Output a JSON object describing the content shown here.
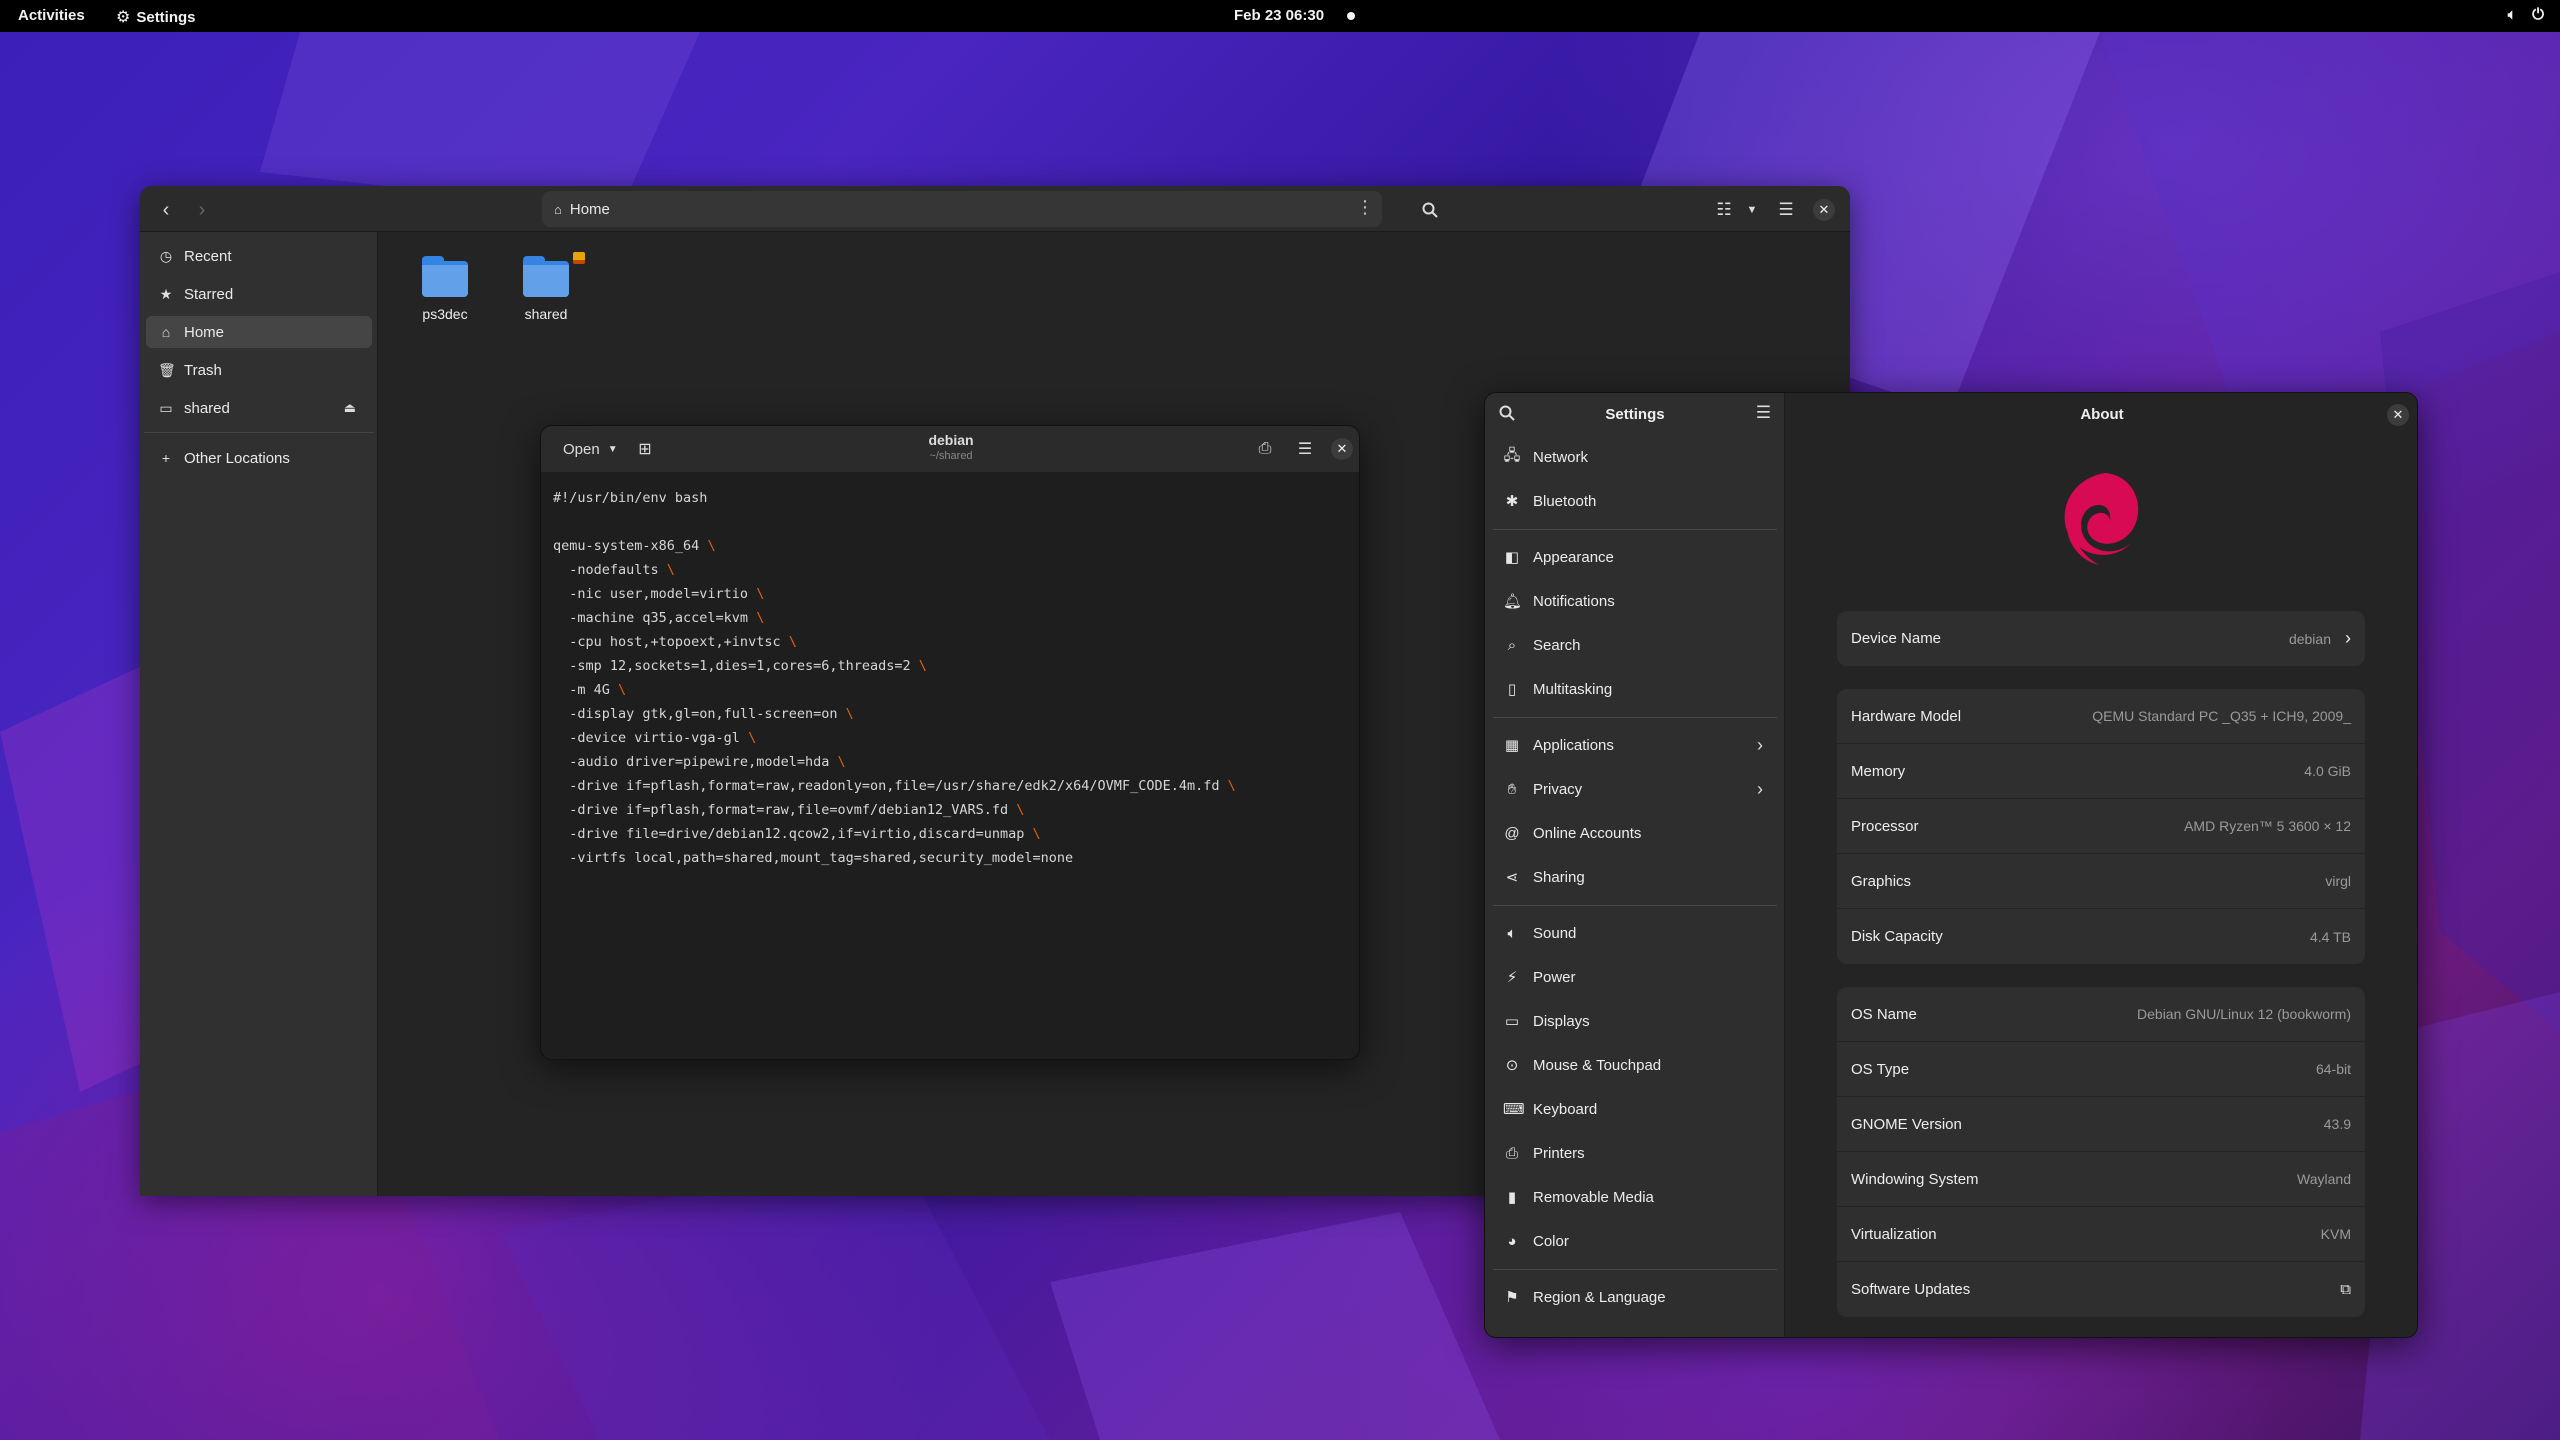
{
  "topbar": {
    "activities": "Activities",
    "app_name": "Settings",
    "clock": "Feb 23  06:30"
  },
  "files": {
    "path": "Home",
    "sidebar": [
      {
        "label": "Recent",
        "icon": "clock-icon"
      },
      {
        "label": "Starred",
        "icon": "star-icon"
      },
      {
        "label": "Home",
        "icon": "home-icon"
      },
      {
        "label": "Trash",
        "icon": "trash-icon"
      },
      {
        "label": "shared",
        "icon": "drive-icon"
      },
      {
        "label": "Other Locations",
        "icon": "plus-icon"
      }
    ],
    "folders": [
      {
        "name": "ps3dec"
      },
      {
        "name": "shared"
      }
    ]
  },
  "editor": {
    "open_label": "Open",
    "title": "debian",
    "subtitle": "~/shared",
    "lines": [
      {
        "text": "#!/usr/bin/env bash",
        "cont": false
      },
      {
        "text": "",
        "cont": false
      },
      {
        "text": "qemu-system-x86_64 ",
        "cont": true
      },
      {
        "text": "  -nodefaults ",
        "cont": true
      },
      {
        "text": "  -nic user,model=virtio ",
        "cont": true
      },
      {
        "text": "  -machine q35,accel=kvm ",
        "cont": true
      },
      {
        "text": "  -cpu host,+topoext,+invtsc ",
        "cont": true
      },
      {
        "text": "  -smp 12,sockets=1,dies=1,cores=6,threads=2 ",
        "cont": true
      },
      {
        "text": "  -m 4G ",
        "cont": true
      },
      {
        "text": "  -display gtk,gl=on,full-screen=on ",
        "cont": true
      },
      {
        "text": "  -device virtio-vga-gl ",
        "cont": true
      },
      {
        "text": "  -audio driver=pipewire,model=hda ",
        "cont": true
      },
      {
        "text": "  -drive if=pflash,format=raw,readonly=on,file=/usr/share/edk2/x64/OVMF_CODE.4m.fd ",
        "cont": true
      },
      {
        "text": "  -drive if=pflash,format=raw,file=ovmf/debian12_VARS.fd ",
        "cont": true
      },
      {
        "text": "  -drive file=drive/debian12.qcow2,if=virtio,discard=unmap ",
        "cont": true
      },
      {
        "text": "  -virtfs local,path=shared,mount_tag=shared,security_model=none",
        "cont": false
      }
    ]
  },
  "settings": {
    "sidebar_title": "Settings",
    "main_title": "About",
    "items": [
      {
        "label": "Network",
        "icon": "network-icon",
        "chevron": false
      },
      {
        "label": "Bluetooth",
        "icon": "bluetooth-icon",
        "chevron": false
      },
      {
        "label": "Appearance",
        "icon": "appearance-icon",
        "chevron": false
      },
      {
        "label": "Notifications",
        "icon": "bell-icon",
        "chevron": false
      },
      {
        "label": "Search",
        "icon": "search-icon",
        "chevron": false
      },
      {
        "label": "Multitasking",
        "icon": "multitasking-icon",
        "chevron": false
      },
      {
        "label": "Applications",
        "icon": "grid-icon",
        "chevron": true
      },
      {
        "label": "Privacy",
        "icon": "hand-icon",
        "chevron": true
      },
      {
        "label": "Online Accounts",
        "icon": "at-icon",
        "chevron": false
      },
      {
        "label": "Sharing",
        "icon": "share-icon",
        "chevron": false
      },
      {
        "label": "Sound",
        "icon": "speaker-icon",
        "chevron": false
      },
      {
        "label": "Power",
        "icon": "power-icon",
        "chevron": false
      },
      {
        "label": "Displays",
        "icon": "display-icon",
        "chevron": false
      },
      {
        "label": "Mouse & Touchpad",
        "icon": "mouse-icon",
        "chevron": false
      },
      {
        "label": "Keyboard",
        "icon": "keyboard-icon",
        "chevron": false
      },
      {
        "label": "Printers",
        "icon": "printer-icon",
        "chevron": false
      },
      {
        "label": "Removable Media",
        "icon": "usb-icon",
        "chevron": false
      },
      {
        "label": "Color",
        "icon": "color-icon",
        "chevron": false
      },
      {
        "label": "Region & Language",
        "icon": "flag-icon",
        "chevron": false
      }
    ],
    "device": {
      "label": "Device Name",
      "value": "debian"
    },
    "hardware": [
      {
        "label": "Hardware Model",
        "value": "QEMU Standard PC _Q35 + ICH9, 2009_"
      },
      {
        "label": "Memory",
        "value": "4.0 GiB"
      },
      {
        "label": "Processor",
        "value": "AMD Ryzen™ 5 3600 × 12"
      },
      {
        "label": "Graphics",
        "value": "virgl"
      },
      {
        "label": "Disk Capacity",
        "value": "4.4 TB"
      }
    ],
    "os": [
      {
        "label": "OS Name",
        "value": "Debian GNU/Linux 12 (bookworm)"
      },
      {
        "label": "OS Type",
        "value": "64-bit"
      },
      {
        "label": "GNOME Version",
        "value": "43.9"
      },
      {
        "label": "Windowing System",
        "value": "Wayland"
      },
      {
        "label": "Virtualization",
        "value": "KVM"
      },
      {
        "label": "Software Updates",
        "value": ""
      }
    ],
    "colors": {
      "accent": "#d70a53",
      "folder": "#62a0ea"
    }
  }
}
